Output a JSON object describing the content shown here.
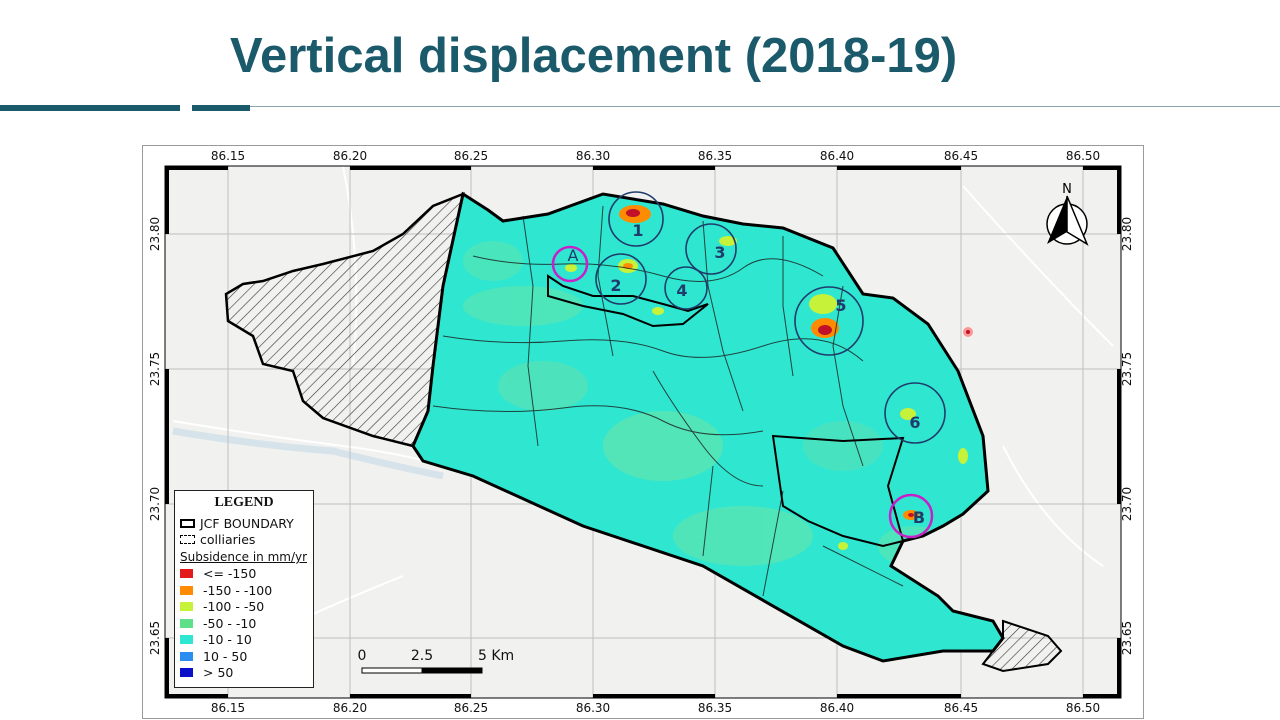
{
  "title": "Vertical displacement (2018-19)",
  "map": {
    "x_ticks": [
      "86.15",
      "86.20",
      "86.25",
      "86.30",
      "86.35",
      "86.40",
      "86.45",
      "86.50"
    ],
    "y_ticks": [
      "23.80",
      "23.75",
      "23.70",
      "23.65"
    ],
    "north_label": "N",
    "zones": [
      "1",
      "2",
      "3",
      "4",
      "5",
      "6"
    ],
    "sites": [
      "A",
      "B"
    ],
    "colors": {
      "subsidence_bg": "#2fe6d0",
      "boundary": "#000000",
      "zone_circle": "#1f3c6b",
      "site_circle": "#c81fc8"
    }
  },
  "legend": {
    "title": "LEGEND",
    "boundary_label": "JCF BOUNDARY",
    "colliery_label": "colliaries",
    "subtitle": "Subsidence in mm/yr",
    "classes": [
      {
        "label": "<= -150",
        "color": "#e31a1c"
      },
      {
        "label": "-150 - -100",
        "color": "#ff8c00"
      },
      {
        "label": "-100 - -50",
        "color": "#c6f23a"
      },
      {
        "label": "-50 - -10",
        "color": "#5ee08a"
      },
      {
        "label": "-10 - 10",
        "color": "#2fe6d0"
      },
      {
        "label": "10 - 50",
        "color": "#2a8ef0"
      },
      {
        "label": "> 50",
        "color": "#0a10c8"
      }
    ]
  },
  "scalebar": {
    "labels": [
      "0",
      "2.5",
      "5 Km"
    ]
  }
}
